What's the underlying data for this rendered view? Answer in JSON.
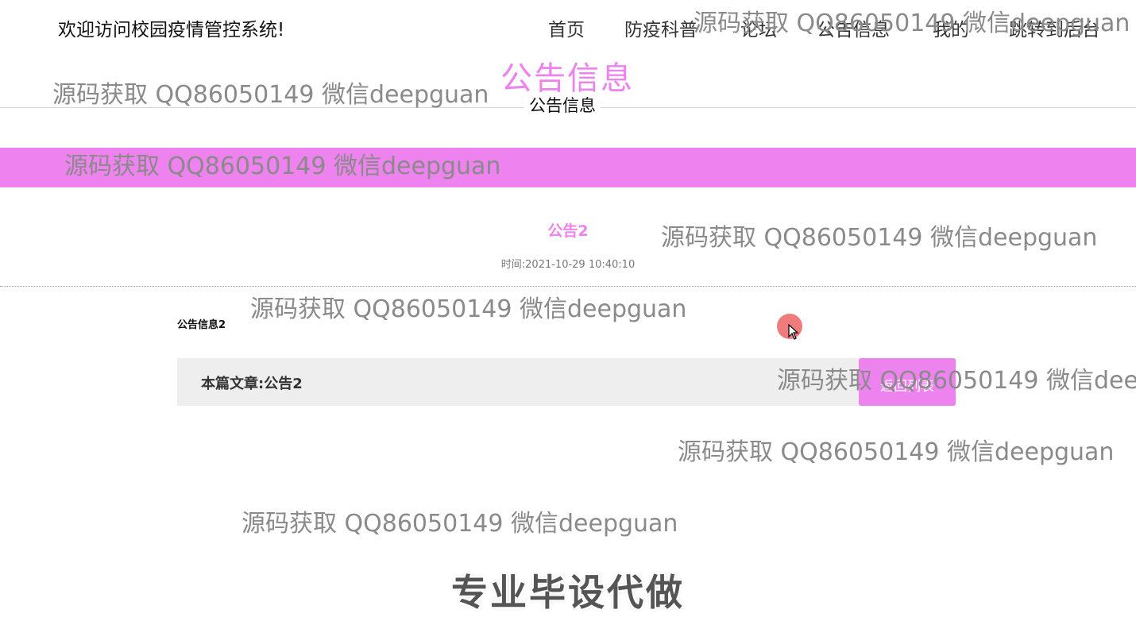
{
  "header": {
    "site_title": "欢迎访问校园疫情管控系统!",
    "nav": [
      "首页",
      "防疫科普",
      "论坛",
      "公告信息",
      "我的",
      "跳转到后台"
    ]
  },
  "page": {
    "heading": "公告信息",
    "section_label": "公告信息"
  },
  "article": {
    "title": "公告2",
    "time_label": "时间:",
    "time_value": "2021-10-29 10:40:10",
    "content": "公告信息2"
  },
  "footer": {
    "label_prefix": "本篇文章:",
    "label_value": "公告2",
    "back_button": "返回列表"
  },
  "watermark_text": "源码获取 QQ86050149 微信deepguan",
  "promo_text": "专业毕设代做",
  "colors": {
    "accent": "#ee82ee",
    "footer_bg": "#eeeeee",
    "watermark": "#8a8a8a"
  },
  "icons": {
    "cursor": "mouse-pointer-icon"
  }
}
